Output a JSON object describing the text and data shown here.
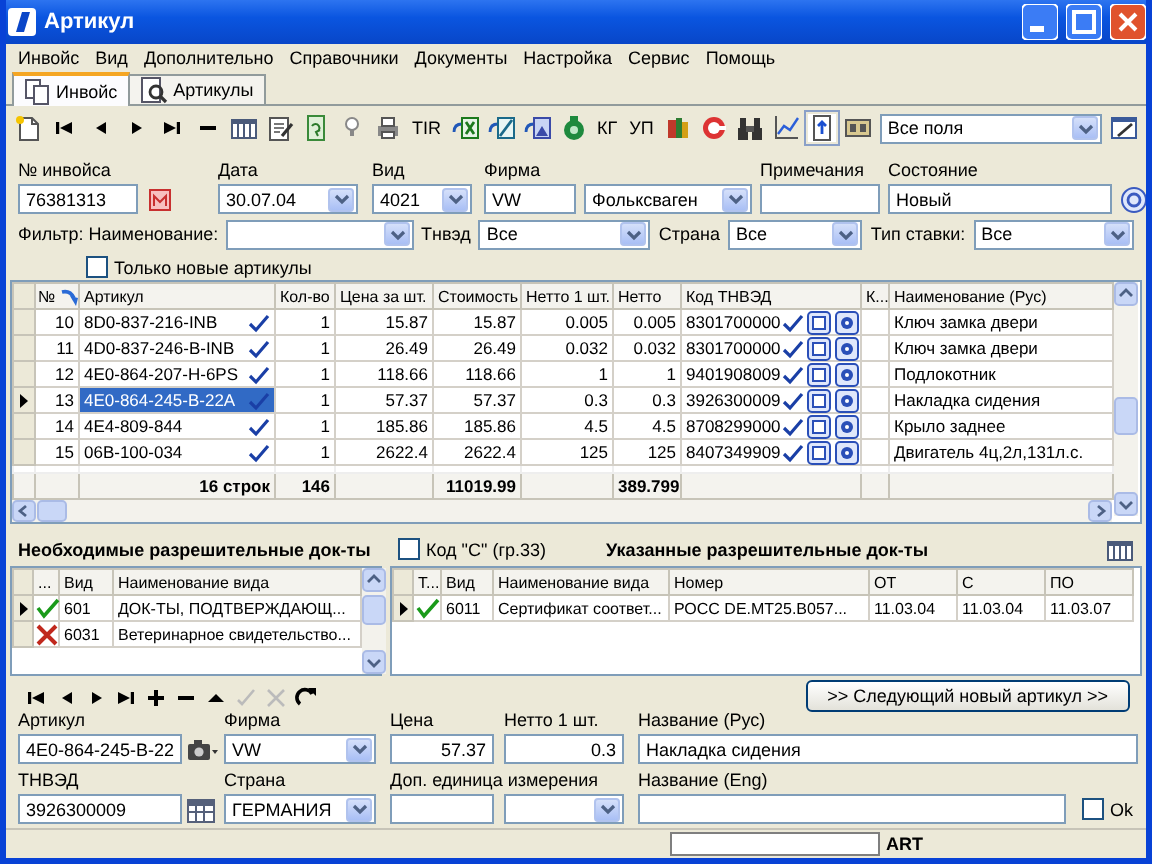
{
  "window": {
    "title": "Артикул"
  },
  "menu": [
    "Инвойс",
    "Вид",
    "Дополнительно",
    "Справочники",
    "Документы",
    "Настройка",
    "Сервис",
    "Помощь"
  ],
  "tabs": [
    {
      "label": "Инвойс",
      "selected": true
    },
    {
      "label": "Артикулы",
      "selected": false
    }
  ],
  "toolbar": {
    "labels": [
      "TIR",
      "КГ",
      "УП"
    ],
    "toggle_pressed": true,
    "field_selector": "Все поля"
  },
  "invoice": {
    "number": {
      "label": "№ инвойса",
      "value": "76381313"
    },
    "date": {
      "label": "Дата",
      "value": "30.07.04"
    },
    "kind": {
      "label": "Вид",
      "value": "4021"
    },
    "firm": {
      "label": "Фирма",
      "code": "VW",
      "name": "Фольксваген"
    },
    "notes": {
      "label": "Примечания"
    },
    "state": {
      "label": "Состояние",
      "value": "Новый"
    }
  },
  "filter": {
    "label": "Фильтр: Наименование:",
    "tnved": {
      "label": "Тнвэд",
      "value": "Все"
    },
    "country": {
      "label": "Страна",
      "value": "Все"
    },
    "rate_type": {
      "label": "Тип ставки:",
      "value": "Все"
    },
    "only_new": {
      "label": "Только новые артикулы",
      "checked": false
    }
  },
  "grid": {
    "columns": [
      "№",
      "Артикул",
      "Кол-во",
      "Цена за шт.",
      "Стоимость",
      "Нетто 1 шт.",
      "Нетто",
      "Код ТНВЭД",
      "К...",
      "Наименование (Рус)"
    ],
    "rows": [
      {
        "num": "10",
        "article": "8D0-837-216-INB",
        "verified": true,
        "qty": "1",
        "price": "15.87",
        "cost": "15.87",
        "net_unit": "0.005",
        "net": "0.005",
        "tnved": "8301700000",
        "tnved_verified": true,
        "name": "Ключ замка двери",
        "selected": false
      },
      {
        "num": "11",
        "article": "4D0-837-246-B-INB",
        "verified": true,
        "qty": "1",
        "price": "26.49",
        "cost": "26.49",
        "net_unit": "0.032",
        "net": "0.032",
        "tnved": "8301700000",
        "tnved_verified": true,
        "name": "Ключ замка двери",
        "selected": false
      },
      {
        "num": "12",
        "article": "4E0-864-207-H-6PS",
        "verified": true,
        "qty": "1",
        "price": "118.66",
        "cost": "118.66",
        "net_unit": "1",
        "net": "1",
        "tnved": "9401908009",
        "tnved_verified": true,
        "name": "Подлокотник",
        "selected": false
      },
      {
        "num": "13",
        "article": "4E0-864-245-B-22A",
        "verified": true,
        "qty": "1",
        "price": "57.37",
        "cost": "57.37",
        "net_unit": "0.3",
        "net": "0.3",
        "tnved": "3926300009",
        "tnved_verified": true,
        "name": "Накладка сидения",
        "selected": true
      },
      {
        "num": "14",
        "article": "4E4-809-844",
        "verified": true,
        "qty": "1",
        "price": "185.86",
        "cost": "185.86",
        "net_unit": "4.5",
        "net": "4.5",
        "tnved": "8708299000",
        "tnved_verified": true,
        "name": "Крыло заднее",
        "selected": false
      },
      {
        "num": "15",
        "article": "06B-100-034",
        "verified": true,
        "qty": "1",
        "price": "2622.4",
        "cost": "2622.4",
        "net_unit": "125",
        "net": "125",
        "tnved": "8407349909",
        "tnved_verified": true,
        "name": "Двигатель 4ц,2л,131л.с.",
        "selected": false
      }
    ],
    "footer": {
      "rows_count": "16 строк",
      "qty": "146",
      "cost": "11019.99",
      "net": "389.799"
    }
  },
  "required_docs": {
    "title": "Необходимые разрешительные док-ты",
    "columns": [
      "...",
      "Вид",
      "Наименование вида"
    ],
    "rows": [
      {
        "selected": true,
        "valid": true,
        "code": "601",
        "name": "ДОК-ТЫ, ПОДТВЕРЖДАЮЩ..."
      },
      {
        "selected": false,
        "valid": false,
        "code": "6031",
        "name": "Ветеринарное свидетельство..."
      }
    ]
  },
  "given_docs": {
    "code_c": {
      "label": "Код \"С\" (гр.33)",
      "checked": false
    },
    "title": "Указанные разрешительные док-ты",
    "columns": [
      "Т...",
      "Вид",
      "Наименование вида",
      "Номер",
      "ОТ",
      "С",
      "ПО"
    ],
    "rows": [
      {
        "selected": true,
        "valid": true,
        "code": "6011",
        "name": "Сертификат соответ...",
        "number": "РОСС DE.MT25.B057...",
        "from": "11.03.04",
        "c": "11.03.04",
        "to": "11.03.07"
      }
    ]
  },
  "article_form": {
    "next_button": ">> Следующий новый артикул >>",
    "article": {
      "label": "Артикул",
      "value": "4E0-864-245-B-22"
    },
    "firm": {
      "label": "Фирма",
      "value": "VW"
    },
    "price": {
      "label": "Цена",
      "value": "57.37"
    },
    "net_unit": {
      "label": "Нетто 1 шт.",
      "value": "0.3"
    },
    "name_rus": {
      "label": "Название (Рус)",
      "value": "Накладка сидения"
    },
    "tnved": {
      "label": "ТНВЭД",
      "value": "3926300009"
    },
    "country": {
      "label": "Страна",
      "value": "ГЕРМАНИЯ"
    },
    "extra_unit": {
      "label": "Доп. единица измерения"
    },
    "name_eng": {
      "label": "Название (Eng)"
    },
    "ok": {
      "label": "Ok",
      "checked": false
    }
  },
  "status_bar": {
    "text": "ART"
  }
}
